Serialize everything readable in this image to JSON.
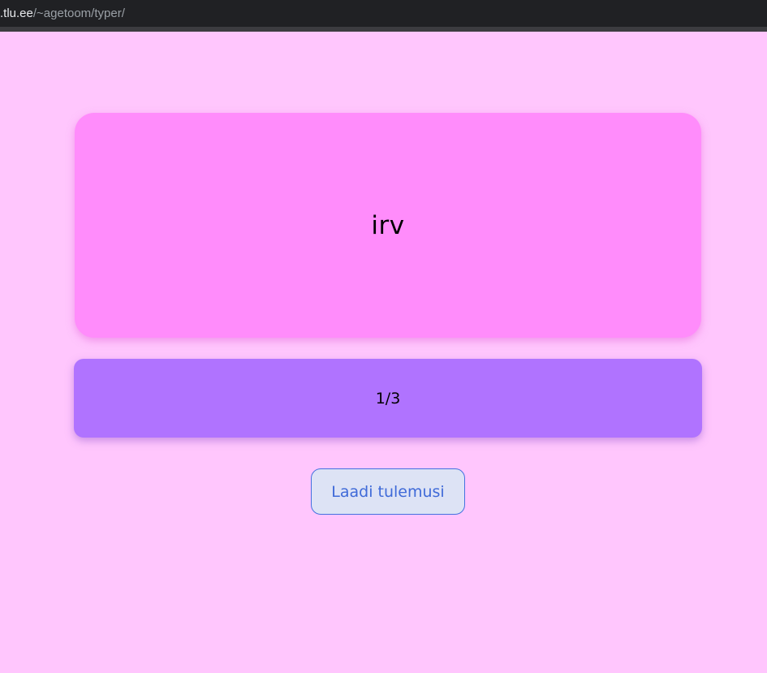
{
  "browser": {
    "url_host": ".tlu.ee",
    "url_path": "/~agetoom/typer/"
  },
  "game": {
    "current_word": "irv",
    "progress_text": "1/3",
    "progress": {
      "current": 1,
      "total": 3
    }
  },
  "actions": {
    "load_results_label": "Laadi tulemusi"
  },
  "colors": {
    "page_background": "#ffc6fd",
    "word_card": "#ff8cfb",
    "progress_card": "#b073ff",
    "button_background": "#dde3f5",
    "button_accent": "#4471e0"
  }
}
